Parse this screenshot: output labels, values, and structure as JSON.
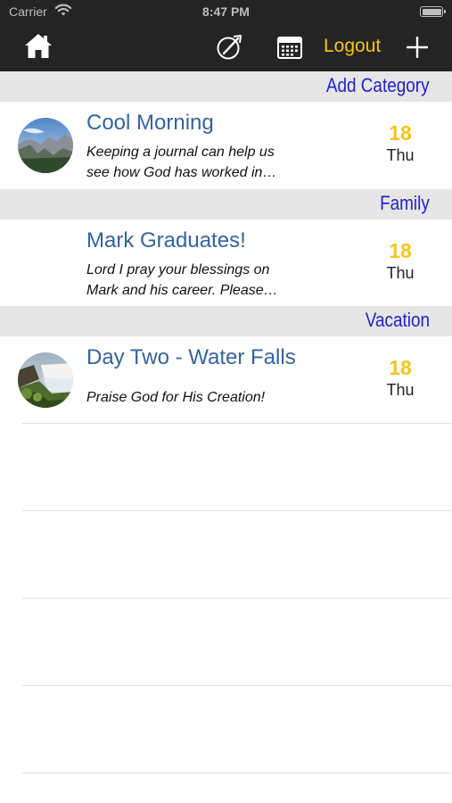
{
  "status_bar": {
    "carrier": "Carrier",
    "time": "8:47 PM"
  },
  "nav": {
    "logout_label": "Logout",
    "accent_color": "#f5c518"
  },
  "sections": [
    {
      "label": "Add Category",
      "entries": [
        {
          "title": "Cool Morning",
          "text": "Keeping a journal can help us see how God has worked in…",
          "day": "18",
          "weekday": "Thu",
          "thumbnail": "mountain-valley"
        }
      ]
    },
    {
      "label": "Family",
      "entries": [
        {
          "title": "Mark Graduates!",
          "text": "Lord I pray your blessings on Mark and his career.  Please…",
          "day": "18",
          "weekday": "Thu",
          "thumbnail": ""
        }
      ]
    },
    {
      "label": "Vacation",
      "entries": [
        {
          "title": "Day Two - Water Falls",
          "text": "Praise God for His Creation!",
          "day": "18",
          "weekday": "Thu",
          "thumbnail": "waterfall"
        }
      ]
    }
  ],
  "colors": {
    "section_label": "#2323c8",
    "entry_title": "#35649a",
    "header_bg": "#242424",
    "section_bg": "#e6e6e6"
  }
}
